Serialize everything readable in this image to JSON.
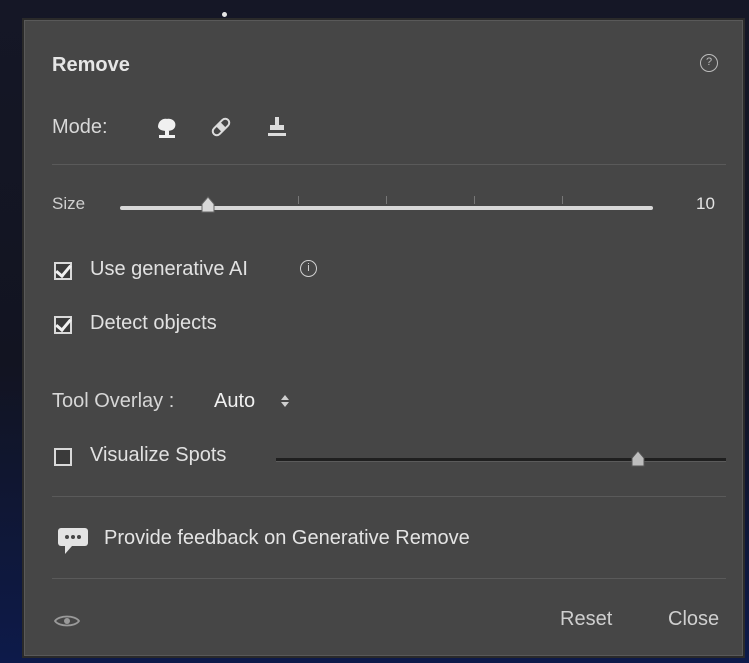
{
  "panel": {
    "title": "Remove",
    "help_icon": "question-icon",
    "mode_label": "Mode:",
    "modes": [
      {
        "name": "remove-tool",
        "icon": "eraser-icon",
        "selected": true
      },
      {
        "name": "heal-tool",
        "icon": "bandage-icon",
        "selected": false
      },
      {
        "name": "clone-tool",
        "icon": "stamp-icon",
        "selected": false
      }
    ],
    "size": {
      "label": "Size",
      "value": "10",
      "slider_fraction": 0.17
    },
    "use_generative_ai": {
      "label": "Use generative AI",
      "checked": true,
      "icon": "info-icon"
    },
    "detect_objects": {
      "label": "Detect objects",
      "checked": true
    },
    "tool_overlay": {
      "label": "Tool Overlay :",
      "value": "Auto"
    },
    "visualize_spots": {
      "label": "Visualize Spots",
      "checked": false,
      "slider_fraction": 0.79
    },
    "feedback": {
      "icon": "chat-bubble-icon",
      "text": "Provide feedback on Generative Remove"
    },
    "footer": {
      "eye_icon": "eye-icon",
      "reset_label": "Reset",
      "close_label": "Close"
    }
  }
}
